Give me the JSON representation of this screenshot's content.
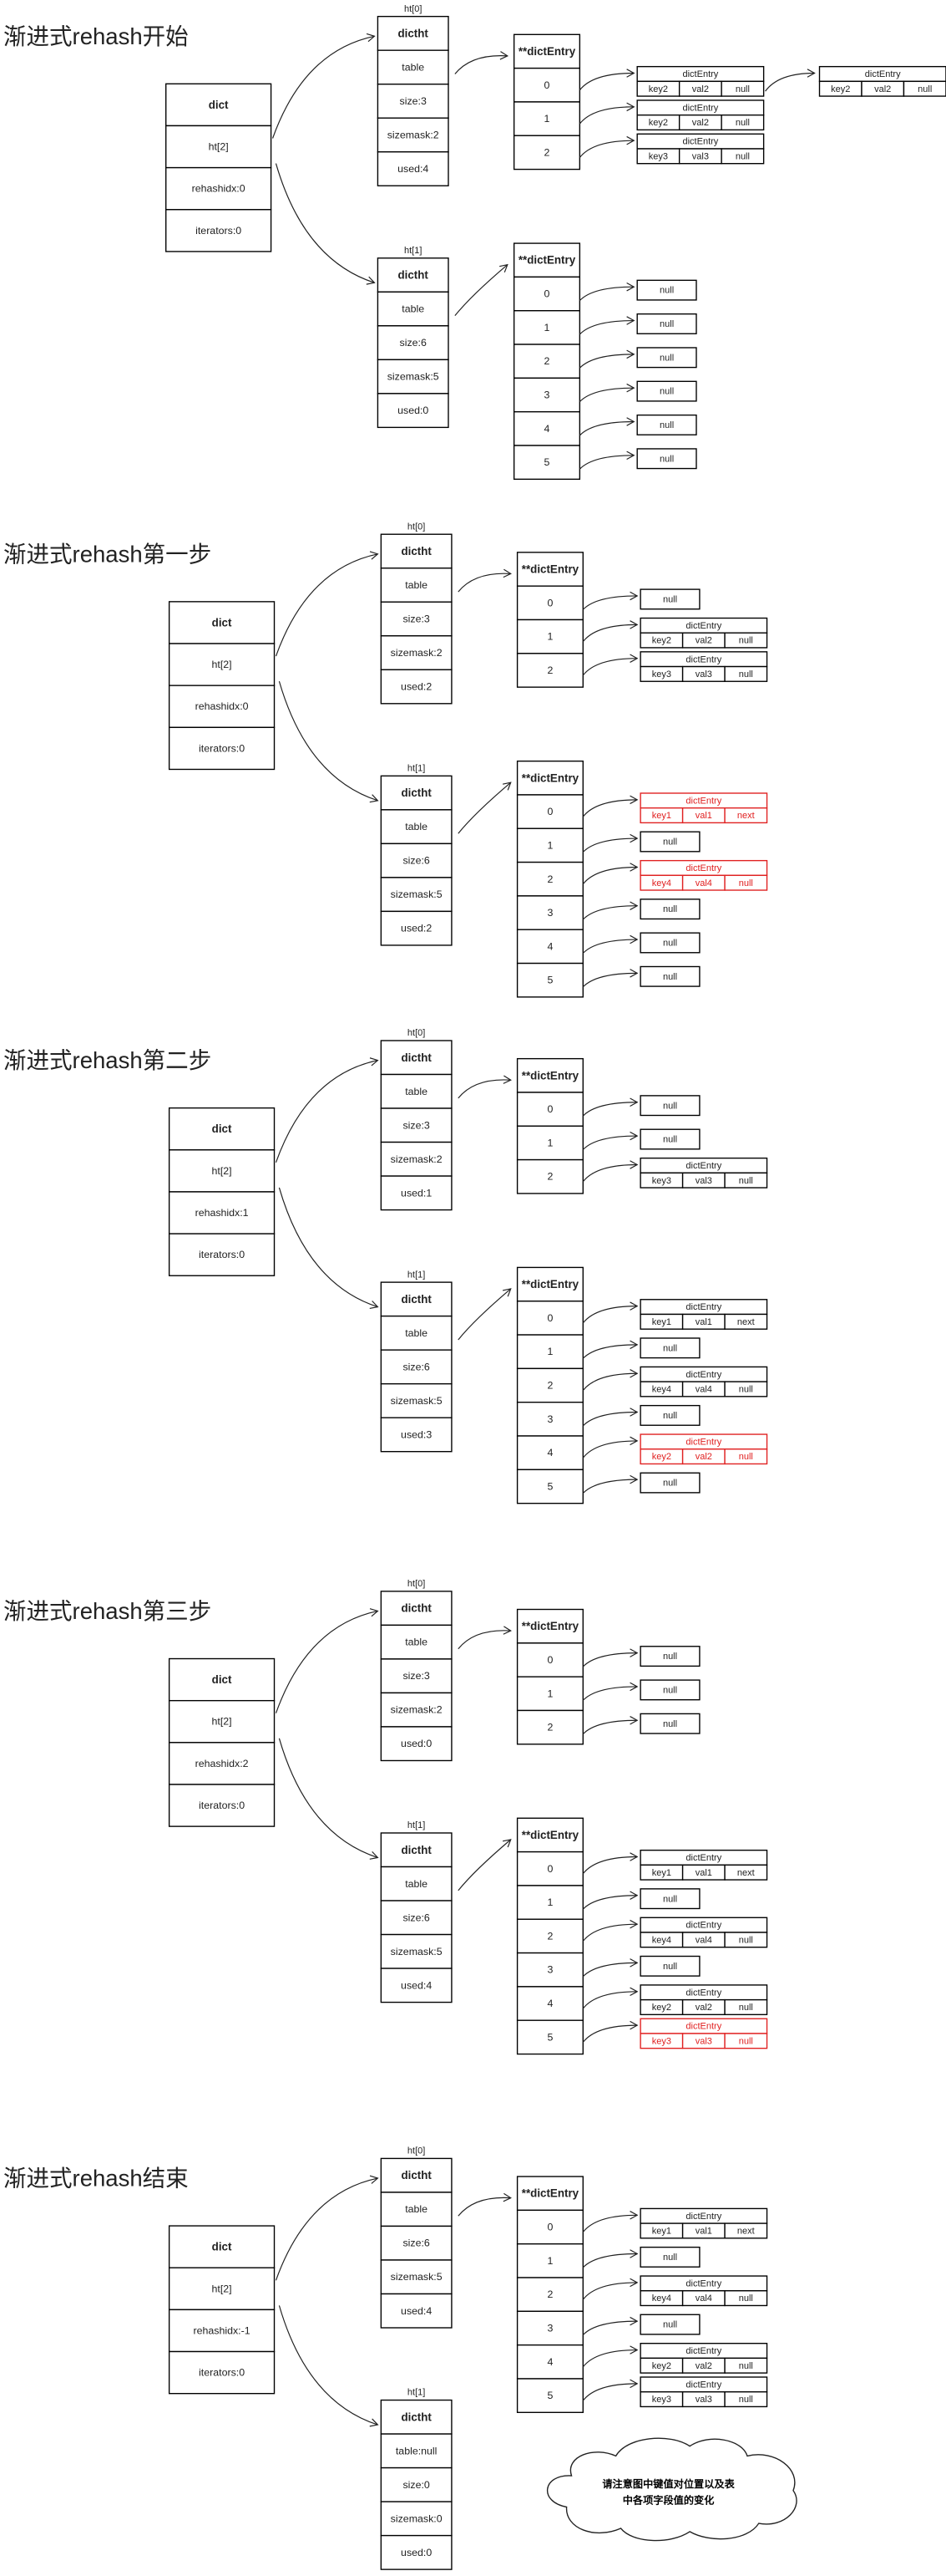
{
  "colors": {
    "highlight": "#e02020",
    "line": "#000000"
  },
  "sections": [
    {
      "title": "渐进式rehash开始",
      "dict": {
        "header": "dict",
        "fields": [
          "ht[2]",
          "rehashidx:0",
          "iterators:0"
        ]
      },
      "ht": [
        {
          "label": "ht[0]",
          "header": "dictht",
          "fields": [
            "table",
            "size:3",
            "sizemask:2",
            "used:4"
          ],
          "table": {
            "header": "**dictEntry",
            "buckets": [
              {
                "index": "0",
                "entries": [
                  {
                    "header": "dictEntry",
                    "key": "key2",
                    "val": "val2",
                    "next": "null"
                  },
                  {
                    "header": "dictEntry",
                    "key": "key2",
                    "val": "val2",
                    "next": "null"
                  }
                ]
              },
              {
                "index": "1",
                "entries": [
                  {
                    "header": "dictEntry",
                    "key": "key2",
                    "val": "val2",
                    "next": "null"
                  }
                ]
              },
              {
                "index": "2",
                "entries": [
                  {
                    "header": "dictEntry",
                    "key": "key3",
                    "val": "val3",
                    "next": "null"
                  }
                ]
              }
            ]
          }
        },
        {
          "label": "ht[1]",
          "header": "dictht",
          "fields": [
            "table",
            "size:6",
            "sizemask:5",
            "used:0"
          ],
          "table": {
            "header": "**dictEntry",
            "buckets": [
              {
                "index": "0",
                "null": "null"
              },
              {
                "index": "1",
                "null": "null"
              },
              {
                "index": "2",
                "null": "null"
              },
              {
                "index": "3",
                "null": "null"
              },
              {
                "index": "4",
                "null": "null"
              },
              {
                "index": "5",
                "null": "null"
              }
            ]
          }
        }
      ]
    },
    {
      "title": "渐进式rehash第一步",
      "dict": {
        "header": "dict",
        "fields": [
          "ht[2]",
          "rehashidx:0",
          "iterators:0"
        ]
      },
      "ht": [
        {
          "label": "ht[0]",
          "header": "dictht",
          "fields": [
            "table",
            "size:3",
            "sizemask:2",
            "used:2"
          ],
          "table": {
            "header": "**dictEntry",
            "buckets": [
              {
                "index": "0",
                "null": "null"
              },
              {
                "index": "1",
                "entries": [
                  {
                    "header": "dictEntry",
                    "key": "key2",
                    "val": "val2",
                    "next": "null"
                  }
                ]
              },
              {
                "index": "2",
                "entries": [
                  {
                    "header": "dictEntry",
                    "key": "key3",
                    "val": "val3",
                    "next": "null"
                  }
                ]
              }
            ]
          }
        },
        {
          "label": "ht[1]",
          "header": "dictht",
          "fields": [
            "table",
            "size:6",
            "sizemask:5",
            "used:2"
          ],
          "table": {
            "header": "**dictEntry",
            "buckets": [
              {
                "index": "0",
                "entries": [
                  {
                    "header": "dictEntry",
                    "key": "key1",
                    "val": "val1",
                    "next": "next",
                    "highlight": true
                  }
                ]
              },
              {
                "index": "1",
                "null": "null"
              },
              {
                "index": "2",
                "entries": [
                  {
                    "header": "dictEntry",
                    "key": "key4",
                    "val": "val4",
                    "next": "null",
                    "highlight": true
                  }
                ]
              },
              {
                "index": "3",
                "null": "null"
              },
              {
                "index": "4",
                "null": "null"
              },
              {
                "index": "5",
                "null": "null"
              }
            ]
          }
        }
      ]
    },
    {
      "title": "渐进式rehash第二步",
      "dict": {
        "header": "dict",
        "fields": [
          "ht[2]",
          "rehashidx:1",
          "iterators:0"
        ]
      },
      "ht": [
        {
          "label": "ht[0]",
          "header": "dictht",
          "fields": [
            "table",
            "size:3",
            "sizemask:2",
            "used:1"
          ],
          "table": {
            "header": "**dictEntry",
            "buckets": [
              {
                "index": "0",
                "null": "null"
              },
              {
                "index": "1",
                "null": "null"
              },
              {
                "index": "2",
                "entries": [
                  {
                    "header": "dictEntry",
                    "key": "key3",
                    "val": "val3",
                    "next": "null"
                  }
                ]
              }
            ]
          }
        },
        {
          "label": "ht[1]",
          "header": "dictht",
          "fields": [
            "table",
            "size:6",
            "sizemask:5",
            "used:3"
          ],
          "table": {
            "header": "**dictEntry",
            "buckets": [
              {
                "index": "0",
                "entries": [
                  {
                    "header": "dictEntry",
                    "key": "key1",
                    "val": "val1",
                    "next": "next"
                  }
                ]
              },
              {
                "index": "1",
                "null": "null"
              },
              {
                "index": "2",
                "entries": [
                  {
                    "header": "dictEntry",
                    "key": "key4",
                    "val": "val4",
                    "next": "null"
                  }
                ]
              },
              {
                "index": "3",
                "null": "null"
              },
              {
                "index": "4",
                "entries": [
                  {
                    "header": "dictEntry",
                    "key": "key2",
                    "val": "val2",
                    "next": "null",
                    "highlight": true
                  }
                ]
              },
              {
                "index": "5",
                "null": "null"
              }
            ]
          }
        }
      ]
    },
    {
      "title": "渐进式rehash第三步",
      "dict": {
        "header": "dict",
        "fields": [
          "ht[2]",
          "rehashidx:2",
          "iterators:0"
        ]
      },
      "ht": [
        {
          "label": "ht[0]",
          "header": "dictht",
          "fields": [
            "table",
            "size:3",
            "sizemask:2",
            "used:0"
          ],
          "table": {
            "header": "**dictEntry",
            "buckets": [
              {
                "index": "0",
                "null": "null"
              },
              {
                "index": "1",
                "null": "null"
              },
              {
                "index": "2",
                "null": "null"
              }
            ]
          }
        },
        {
          "label": "ht[1]",
          "header": "dictht",
          "fields": [
            "table",
            "size:6",
            "sizemask:5",
            "used:4"
          ],
          "table": {
            "header": "**dictEntry",
            "buckets": [
              {
                "index": "0",
                "entries": [
                  {
                    "header": "dictEntry",
                    "key": "key1",
                    "val": "val1",
                    "next": "next"
                  }
                ]
              },
              {
                "index": "1",
                "null": "null"
              },
              {
                "index": "2",
                "entries": [
                  {
                    "header": "dictEntry",
                    "key": "key4",
                    "val": "val4",
                    "next": "null"
                  }
                ]
              },
              {
                "index": "3",
                "null": "null"
              },
              {
                "index": "4",
                "entries": [
                  {
                    "header": "dictEntry",
                    "key": "key2",
                    "val": "val2",
                    "next": "null"
                  }
                ]
              },
              {
                "index": "5",
                "entries": [
                  {
                    "header": "dictEntry",
                    "key": "key3",
                    "val": "val3",
                    "next": "null",
                    "highlight": true
                  }
                ]
              }
            ]
          }
        }
      ]
    },
    {
      "title": "渐进式rehash结束",
      "dict": {
        "header": "dict",
        "fields": [
          "ht[2]",
          "rehashidx:-1",
          "iterators:0"
        ]
      },
      "ht": [
        {
          "label": "ht[0]",
          "header": "dictht",
          "fields": [
            "table",
            "size:6",
            "sizemask:5",
            "used:4"
          ],
          "table": {
            "header": "**dictEntry",
            "buckets": [
              {
                "index": "0",
                "entries": [
                  {
                    "header": "dictEntry",
                    "key": "key1",
                    "val": "val1",
                    "next": "next"
                  }
                ]
              },
              {
                "index": "1",
                "null": "null"
              },
              {
                "index": "2",
                "entries": [
                  {
                    "header": "dictEntry",
                    "key": "key4",
                    "val": "val4",
                    "next": "null"
                  }
                ]
              },
              {
                "index": "3",
                "null": "null"
              },
              {
                "index": "4",
                "entries": [
                  {
                    "header": "dictEntry",
                    "key": "key2",
                    "val": "val2",
                    "next": "null"
                  }
                ]
              },
              {
                "index": "5",
                "entries": [
                  {
                    "header": "dictEntry",
                    "key": "key3",
                    "val": "val3",
                    "next": "null"
                  }
                ]
              }
            ]
          }
        },
        {
          "label": "ht[1]",
          "header": "dictht",
          "fields": [
            "table:null",
            "size:0",
            "sizemask:0",
            "used:0"
          ]
        }
      ]
    }
  ],
  "note": {
    "line1": "请注意图中键值对位置以及表",
    "line2": "中各项字段值的变化"
  }
}
